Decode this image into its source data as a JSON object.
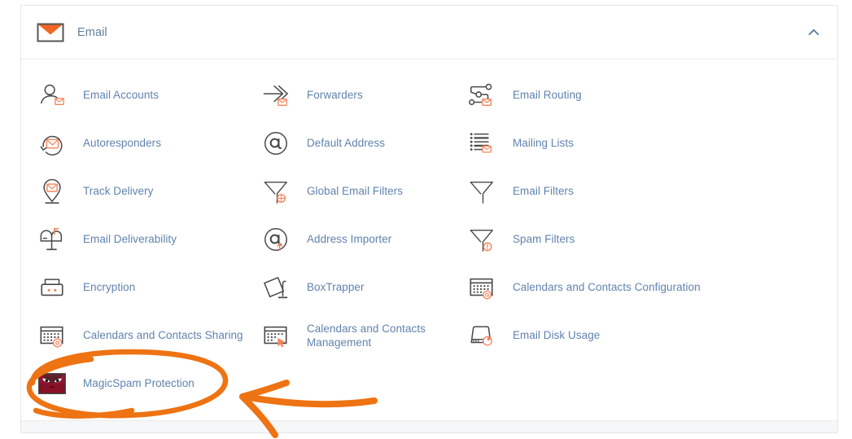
{
  "card": {
    "header": {
      "title": "Email",
      "icon": "envelope-icon",
      "collapse_icon": "chevron-up-icon",
      "collapsed": false
    },
    "items": [
      {
        "label": "Email Accounts",
        "icon": "user-envelope-icon"
      },
      {
        "label": "Forwarders",
        "icon": "arrow-forward-envelope-icon"
      },
      {
        "label": "Email Routing",
        "icon": "routing-nodes-envelope-icon"
      },
      {
        "label": "Autoresponders",
        "icon": "circular-arrow-envelope-icon"
      },
      {
        "label": "Default Address",
        "icon": "at-sign-circle-icon"
      },
      {
        "label": "Mailing Lists",
        "icon": "list-envelope-icon"
      },
      {
        "label": "Track Delivery",
        "icon": "map-pin-envelope-icon"
      },
      {
        "label": "Global Email Filters",
        "icon": "funnel-globe-icon"
      },
      {
        "label": "Email Filters",
        "icon": "funnel-icon"
      },
      {
        "label": "Email Deliverability",
        "icon": "mailbox-icon"
      },
      {
        "label": "Address Importer",
        "icon": "at-sign-upload-icon"
      },
      {
        "label": "Spam Filters",
        "icon": "funnel-alert-icon"
      },
      {
        "label": "Encryption",
        "icon": "lock-icon"
      },
      {
        "label": "BoxTrapper",
        "icon": "box-trap-icon"
      },
      {
        "label": "Calendars and Contacts Configuration",
        "icon": "calendar-at-icon"
      },
      {
        "label": "Calendars and Contacts Sharing",
        "icon": "calendar-gear-icon"
      },
      {
        "label": "Calendars and Contacts Management",
        "icon": "calendar-cursor-icon"
      },
      {
        "label": "Email Disk Usage",
        "icon": "disk-pie-icon"
      },
      {
        "label": "MagicSpam Protection",
        "icon": "magicspam-angry-envelope-icon"
      }
    ]
  },
  "annotation": {
    "color": "#ee7313",
    "shapes": [
      "ellipse-highlight",
      "arrow-pointer"
    ],
    "target_label": "MagicSpam Protection"
  },
  "colors": {
    "link": "#6083ad",
    "header_text": "#5f7d9c",
    "icon_stroke": "#4a4a4a",
    "icon_accent": "#f5845c",
    "card_border": "#e4e7ea",
    "annotation": "#ee7313",
    "magicspam_red": "#8e1228"
  }
}
